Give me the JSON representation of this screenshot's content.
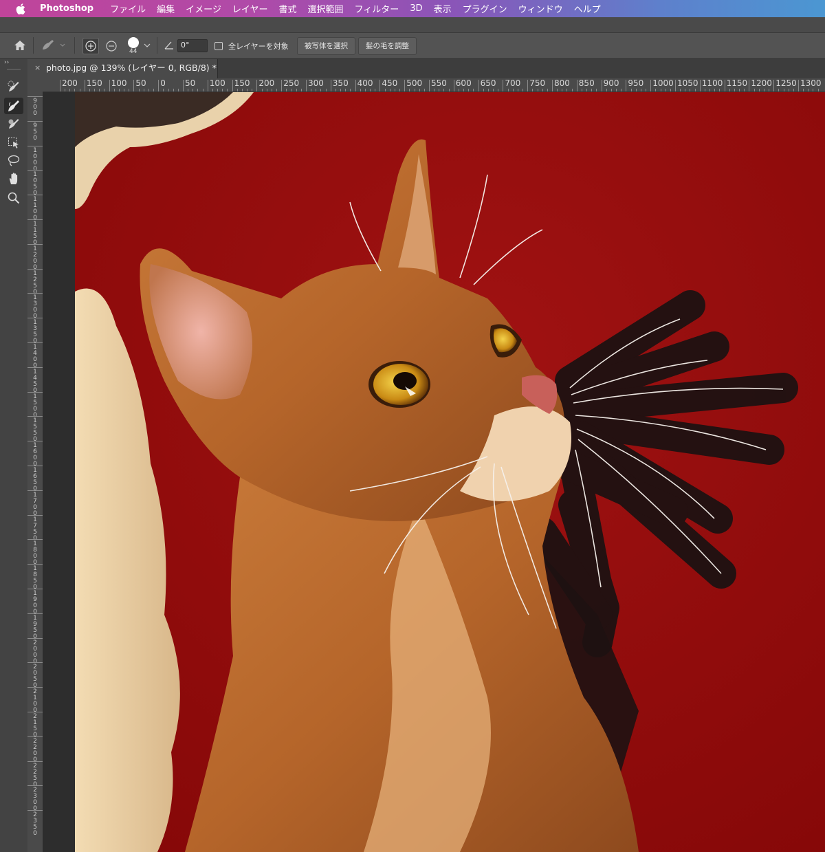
{
  "menubar": {
    "app_name": "Photoshop",
    "items": [
      "ファイル",
      "編集",
      "イメージ",
      "レイヤー",
      "書式",
      "選択範囲",
      "フィルター",
      "3D",
      "表示",
      "プラグイン",
      "ウィンドウ",
      "ヘルプ"
    ]
  },
  "options": {
    "brush_size": "44",
    "angle": "0°",
    "sample_all_layers_label": "全レイヤーを対象",
    "sample_all_layers_checked": false,
    "select_subject_label": "被写体を選択",
    "refine_hair_label": "髪の毛を調整"
  },
  "document": {
    "tab_title": "photo.jpg @ 139% (レイヤー 0, RGB/8) *",
    "close_glyph": "×"
  },
  "rulers": {
    "horizontal": [
      "200",
      "150",
      "100",
      "50",
      "0",
      "50",
      "100",
      "150",
      "200",
      "250",
      "300",
      "350",
      "400",
      "450",
      "500",
      "550",
      "600",
      "650",
      "700",
      "750",
      "800",
      "850",
      "900",
      "950",
      "1000",
      "1050",
      "1100",
      "1150",
      "1200",
      "1250",
      "1300"
    ],
    "vertical": [
      "900",
      "950",
      "1000",
      "1050",
      "1100",
      "1150",
      "1200",
      "1250",
      "1300",
      "1350",
      "1400",
      "1450",
      "1500",
      "1550",
      "1600",
      "1650",
      "1700",
      "1750",
      "1800",
      "1850",
      "1900",
      "1950",
      "2000",
      "2050",
      "2100",
      "2150",
      "2200",
      "2250",
      "2300",
      "2350"
    ]
  },
  "tools": [
    {
      "name": "quick-selection-icon",
      "active": false
    },
    {
      "name": "refine-edge-brush-icon",
      "active": true
    },
    {
      "name": "brush-icon",
      "active": false
    },
    {
      "name": "object-selection-icon",
      "active": false
    },
    {
      "name": "lasso-icon",
      "active": false
    },
    {
      "name": "hand-icon",
      "active": false
    },
    {
      "name": "zoom-icon",
      "active": false
    }
  ],
  "colors": {
    "canvas_background": "#8e0c0c",
    "brush_overlay": "#1e1212",
    "cat_fur": "#b8692a"
  }
}
